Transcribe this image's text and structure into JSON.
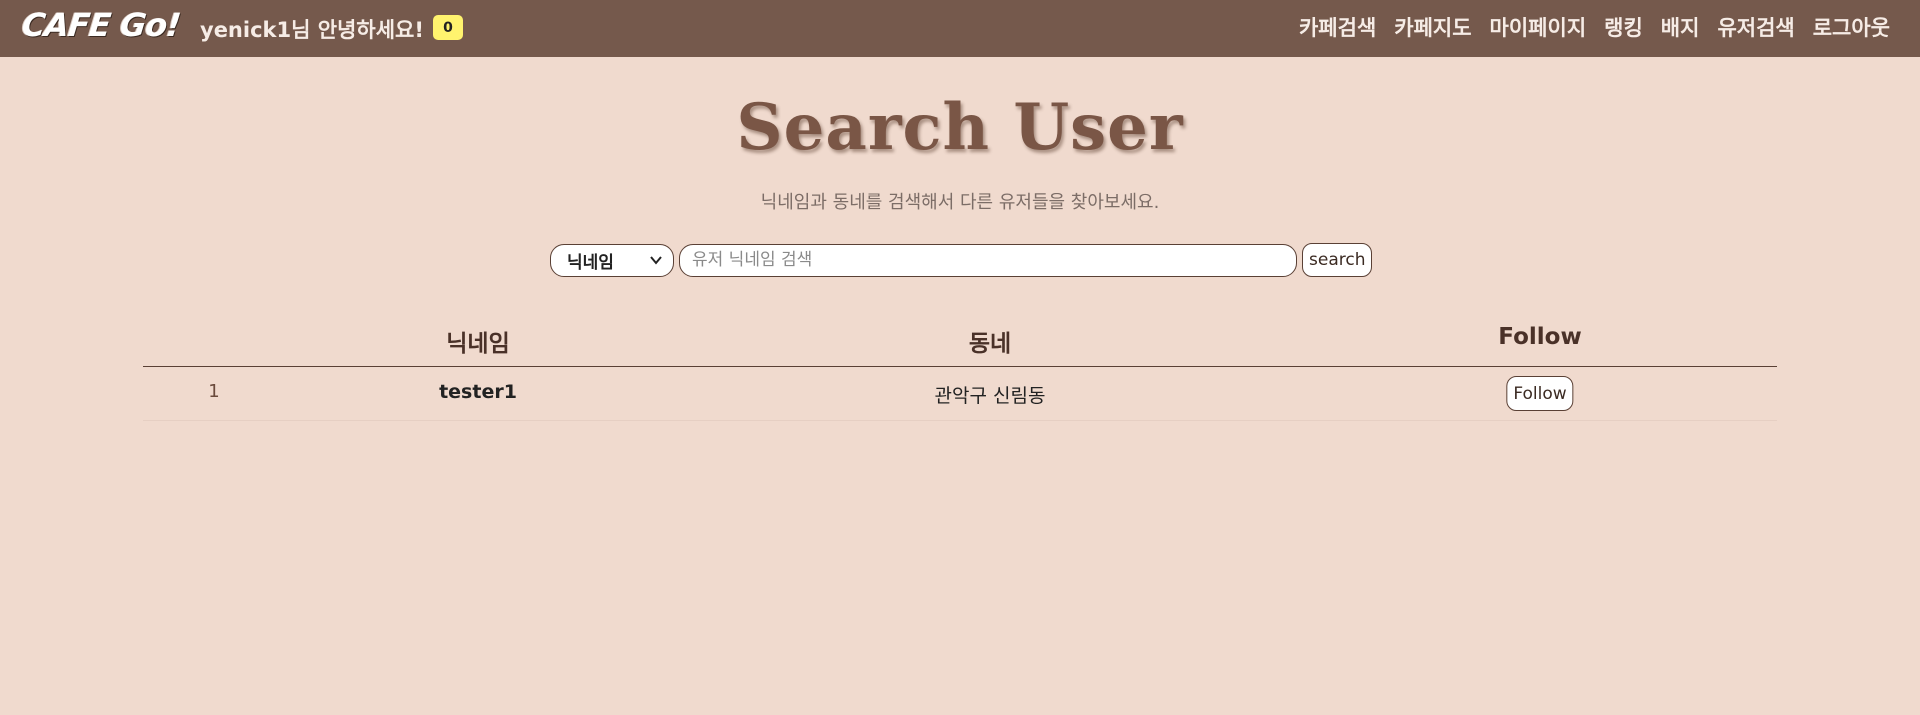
{
  "navbar": {
    "logo": "CAFE Go!",
    "greeting": "yenick1님 안녕하세요!",
    "notification_count": "0",
    "menu": [
      "카페검색",
      "카페지도",
      "마이페이지",
      "랭킹",
      "배지",
      "유저검색",
      "로그아웃"
    ]
  },
  "header": {
    "title": "Search User",
    "subtitle": "닉네임과 동네를 검색해서 다른 유저들을 찾아보세요."
  },
  "search": {
    "selected_option": "닉네임",
    "input_value": "",
    "placeholder": "유저 닉네임 검색",
    "button_label": "search"
  },
  "table": {
    "columns": [
      "닉네임",
      "동네",
      "Follow"
    ],
    "rows": [
      {
        "index": "1",
        "nickname": "tester1",
        "neighborhood": "관악구 신림동",
        "follow_label": "Follow"
      }
    ]
  },
  "colors": {
    "navbar_bg": "#75594c",
    "page_bg": "#f0dace",
    "title": "#7a5646",
    "badge": "#fff36e"
  }
}
